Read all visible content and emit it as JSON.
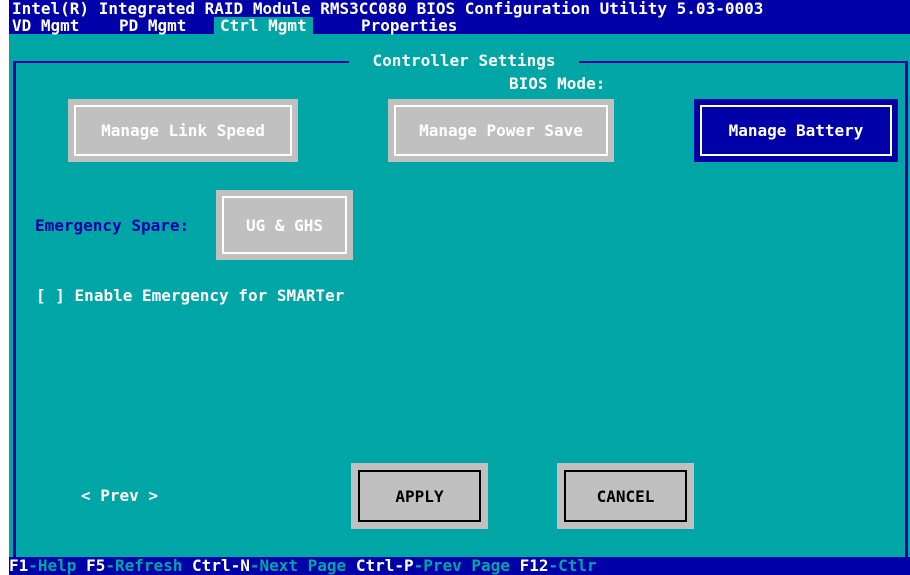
{
  "window": {
    "title": "Intel(R) Integrated RAID Module RMS3CC080 BIOS Configuration Utility 5.03-0003"
  },
  "tabs": [
    {
      "label": "VD Mgmt",
      "active": false
    },
    {
      "label": "PD Mgmt",
      "active": false
    },
    {
      "label": "Ctrl Mgmt",
      "active": true
    },
    {
      "label": "Properties",
      "active": false
    }
  ],
  "section": {
    "title": "Controller Settings",
    "bios_mode_label": "BIOS Mode:"
  },
  "buttons": {
    "manage_link_speed": "Manage Link Speed",
    "manage_power_save": "Manage Power Save",
    "manage_battery": "Manage Battery"
  },
  "emergency": {
    "label": "Emergency Spare:",
    "value": "UG & GHS"
  },
  "smarter": {
    "checkbox": "[ ]",
    "label": "Enable Emergency for SMARTer"
  },
  "pager": {
    "prev": "< Prev >"
  },
  "actions": {
    "apply": "APPLY",
    "cancel": "CANCEL"
  },
  "status_bar": [
    {
      "key": "F1",
      "desc": "-Help"
    },
    {
      "key": "F5",
      "desc": "-Refresh"
    },
    {
      "key": "Ctrl-N",
      "desc": "-Next Page"
    },
    {
      "key": "Ctrl-P",
      "desc": "-Prev Page"
    },
    {
      "key": "F12",
      "desc": "-Ctlr"
    }
  ],
  "colors": {
    "background": "#00a5a5",
    "bar": "#0000a8",
    "button_gray": "#c0c0c0",
    "text": "#ffffff"
  }
}
